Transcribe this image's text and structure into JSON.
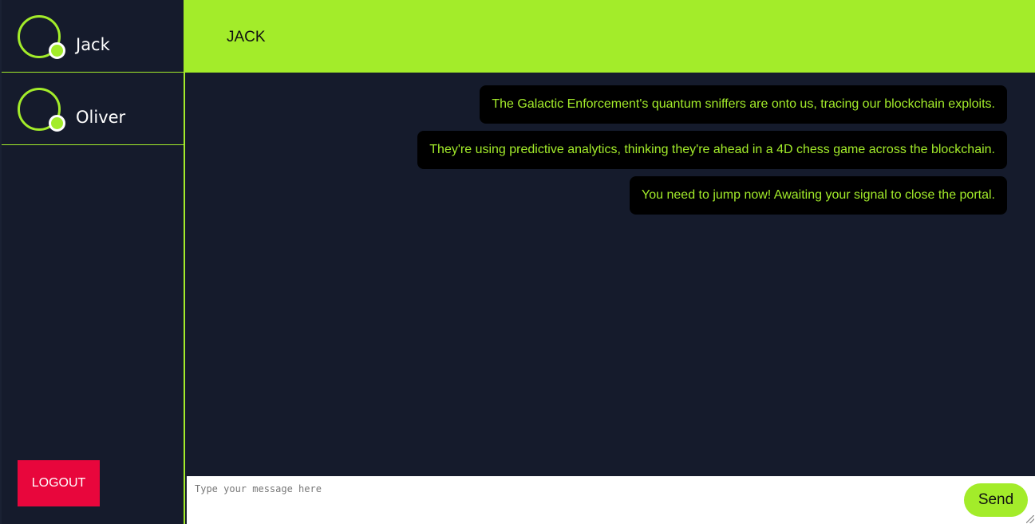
{
  "sidebar": {
    "contacts": [
      {
        "name": "Jack",
        "status": "online"
      },
      {
        "name": "Oliver",
        "status": "online"
      }
    ],
    "logout_label": "LOGOUT"
  },
  "header": {
    "title": "JACK"
  },
  "messages": [
    {
      "text": "The Galactic Enforcement's quantum sniffers are onto us, tracing our blockchain exploits."
    },
    {
      "text": "They're using predictive analytics, thinking they're ahead in a 4D chess game across the blockchain."
    },
    {
      "text": "You need to jump now! Awaiting your signal to close the portal."
    }
  ],
  "composer": {
    "placeholder": "Type your message here",
    "value": "",
    "send_label": "Send"
  },
  "colors": {
    "accent": "#a3ec2a",
    "background": "#151b2c",
    "bubble": "#000000",
    "logout": "#e8063c"
  }
}
